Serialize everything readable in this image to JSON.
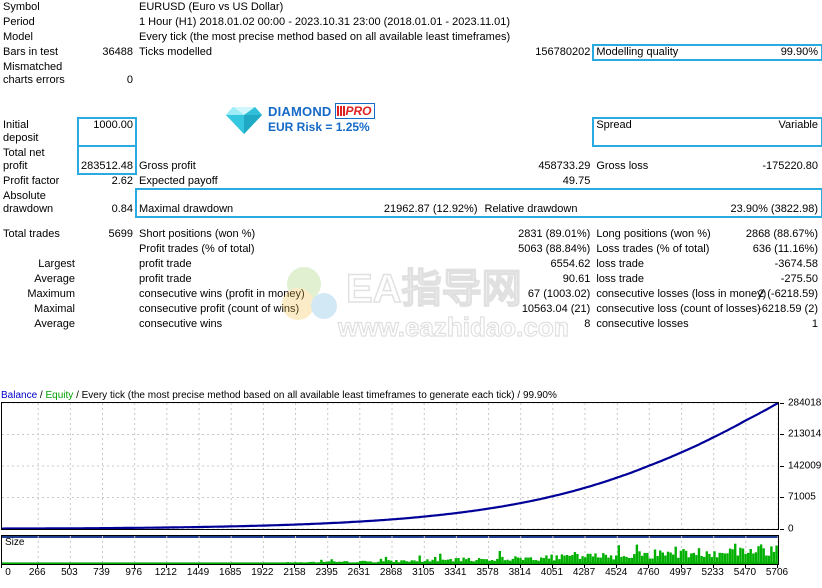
{
  "report": {
    "rows": [
      {
        "label": "Symbol",
        "value": "",
        "mid": "EURUSD (Euro vs US Dollar)",
        "right_label": "",
        "right_value": ""
      },
      {
        "label": "Period",
        "value": "",
        "mid": "1 Hour (H1) 2018.01.02 00:00 - 2023.10.31 23:00 (2018.01.01 - 2023.11.01)",
        "right_label": "",
        "right_value": ""
      },
      {
        "label": "Model",
        "value": "",
        "mid": "Every tick (the most precise method based on all available least timeframes)",
        "right_label": "",
        "right_value": ""
      }
    ],
    "bars_in_test": {
      "label": "Bars in test",
      "value": "36488"
    },
    "ticks_modelled": {
      "label": "Ticks modelled",
      "value": "156780202"
    },
    "modelling_quality": {
      "label": "Modelling quality",
      "value": "99.90%"
    },
    "mismatched": {
      "label": "Mismatched charts errors",
      "label_line1": "Mismatched",
      "label_line2": "charts errors",
      "value": "0"
    },
    "initial_deposit": {
      "label": "Initial deposit",
      "label_line1": "Initial",
      "label_line2": "deposit",
      "value": "1000.00"
    },
    "spread": {
      "label": "Spread",
      "value": "Variable"
    },
    "total_net_profit": {
      "label": "Total net profit",
      "label_line1": "Total net",
      "label_line2": "profit",
      "value": "283512.48"
    },
    "gross_profit": {
      "label": "Gross profit",
      "value": "458733.29"
    },
    "gross_loss": {
      "label": "Gross loss",
      "value": "-175220.80"
    },
    "profit_factor": {
      "label": "Profit factor",
      "value": "2.62"
    },
    "expected_payoff": {
      "label": "Expected payoff",
      "value": "49.75"
    },
    "absolute_drawdown": {
      "label": "Absolute drawdown",
      "label_line1": "Absolute",
      "label_line2": "drawdown",
      "value": "0.84"
    },
    "maximal_drawdown": {
      "label": "Maximal drawdown",
      "value": "21962.87 (12.92%)"
    },
    "relative_drawdown": {
      "label": "Relative drawdown",
      "value": "23.90% (3822.98)"
    },
    "total_trades": {
      "label": "Total trades",
      "value": "5699"
    },
    "short_positions": {
      "label": "Short positions (won %)",
      "value": "2831 (89.01%)"
    },
    "long_positions": {
      "label": "Long positions (won %)",
      "value": "2868 (88.67%)"
    },
    "profit_trades": {
      "label": "Profit trades (% of total)",
      "value": "5063 (88.84%)"
    },
    "loss_trades": {
      "label": "Loss trades (% of total)",
      "value": "636 (11.16%)"
    },
    "largest": {
      "prefix": "Largest",
      "left_label": "profit trade",
      "left_value": "6554.62",
      "right_label": "loss trade",
      "right_value": "-3674.58"
    },
    "average": {
      "prefix": "Average",
      "left_label": "profit trade",
      "left_value": "90.61",
      "right_label": "loss trade",
      "right_value": "-275.50"
    },
    "maximum_consecutive": {
      "prefix": "Maximum",
      "left_label": "consecutive wins (profit in money)",
      "left_value": "67 (1003.02)",
      "right_label": "consecutive losses (loss in money)",
      "right_value": "2 (-6218.59)"
    },
    "maximal_consecutive": {
      "prefix": "Maximal",
      "left_label": "consecutive profit (count of wins)",
      "left_value": "10563.04 (21)",
      "right_label": "consecutive loss (count of losses)",
      "right_value": "-6218.59 (2)"
    },
    "average_consecutive": {
      "prefix": "Average",
      "left_label": "consecutive wins",
      "left_value": "8",
      "right_label": "consecutive losses",
      "right_value": "1"
    }
  },
  "logo": {
    "diamond_word": "DIAMOND",
    "pro_word": "PRO",
    "risk_line": "EUR Risk = 1.25%",
    "accent_blue": "#1569C7",
    "accent_red": "#E02020",
    "gem_color": "#4FD3E8"
  },
  "watermark": {
    "line1": "EA指导网",
    "line2": "www.eazhidao.com"
  },
  "chart_data": {
    "type": "line",
    "title": "Balance / Equity / Every tick (the most precise method based on all available least timeframes to generate each tick) / 99.90%",
    "legend": [
      {
        "name": "Balance",
        "color": "#0000CC"
      },
      {
        "name": "Equity",
        "color": "#00A000"
      }
    ],
    "title_rest": "/ Every tick (the most precise method based on all available least timeframes to generate each tick) / 99.90%",
    "xlabel": "",
    "ylabel": "",
    "ylim": [
      0,
      284018
    ],
    "yticks": [
      0,
      71005,
      142009,
      213014,
      284018
    ],
    "ytick_labels": [
      "0",
      "71005",
      "142009",
      "213014",
      "284018"
    ],
    "xticks": [
      0,
      266,
      503,
      739,
      976,
      1212,
      1449,
      1685,
      1922,
      2158,
      2395,
      2631,
      2868,
      3105,
      3341,
      3578,
      3814,
      4051,
      4287,
      4524,
      4760,
      4997,
      5233,
      5470,
      5706
    ],
    "grid": true,
    "x": [
      0,
      266,
      503,
      739,
      976,
      1212,
      1449,
      1685,
      1922,
      2158,
      2395,
      2631,
      2868,
      3105,
      3341,
      3578,
      3814,
      4051,
      4287,
      4524,
      4760,
      4997,
      5233,
      5470,
      5706,
      5699
    ],
    "balance": [
      1000,
      1180,
      1500,
      1950,
      2600,
      3400,
      4500,
      5900,
      7700,
      10000,
      13000,
      16800,
      21700,
      28000,
      36000,
      46000,
      58500,
      74000,
      93000,
      116000,
      143000,
      173000,
      207000,
      245000,
      284018,
      283512
    ],
    "size_panel": {
      "label": "Size",
      "type": "bar",
      "color": "#00B000",
      "note": "lot size per trade, growing over time"
    }
  }
}
